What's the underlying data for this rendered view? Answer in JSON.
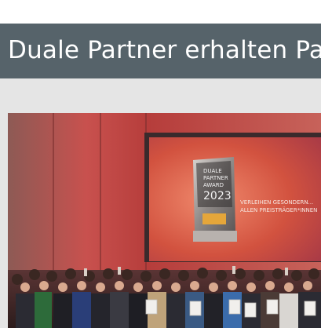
{
  "article": {
    "title": "Duale Partner erhalten Pa"
  },
  "image": {
    "screen_lines": [
      "VERLEIHEN GESONDERN...",
      "ALLEN PREISTRÄGER*INNEN"
    ],
    "trophy_lines": [
      "DUALE",
      "PARTNER",
      "AWARD",
      "2023"
    ]
  },
  "colors": {
    "title_bar": "#56636a",
    "page_bg": "#e5e5e5",
    "stage_red": "#c94a48"
  }
}
